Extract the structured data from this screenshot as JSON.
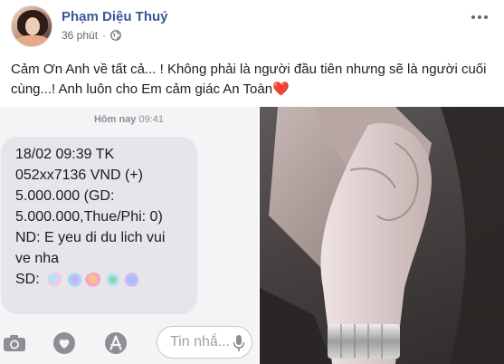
{
  "post": {
    "author": "Phạm Diệu Thuý",
    "time": "36 phút",
    "separator": "·",
    "caption": "Cảm Ơn Anh về tất cả... ! Không phải là người đầu tiên nhưng sẽ là người cuối cùng...! Anh luôn cho Em cảm giác An Toàn",
    "caption_emoji": "❤️"
  },
  "sms": {
    "timestamp_day": "Hôm nay",
    "timestamp_time": "09:41",
    "message_lines": [
      "18/02 09:39 TK",
      "052xx7136 VND (+)",
      "5.000.000 (GD:",
      "5.000.000,Thue/Phi: 0)",
      "ND: E yeu di du lich vui",
      "ve nha",
      "SD:"
    ],
    "input_placeholder": "Tin nhắ..."
  },
  "icons": [
    "camera-icon",
    "heart-digital-touch-icon",
    "app-store-icon",
    "microphone-icon",
    "globe-icon",
    "more-options-icon"
  ]
}
